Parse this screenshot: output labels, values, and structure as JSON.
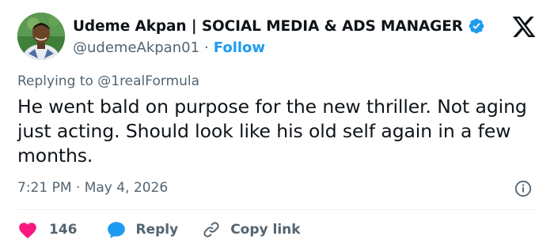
{
  "author": {
    "display_name": "Udeme Akpan | SOCIAL MEDIA & ADS MANAGER",
    "handle": "@udemeAkpan01",
    "separator": "·",
    "follow_label": "Follow",
    "verified": true
  },
  "brand_icon": "x-logo-icon",
  "reply_context": {
    "prefix": "Replying to",
    "mention": "@1realFormula"
  },
  "tweet": {
    "text": "He went bald on purpose for the new thriller. Not aging just acting. Should look like his old self again in a few months.",
    "timestamp": "7:21 PM · May 4, 2026"
  },
  "actions": {
    "like_count": "146",
    "reply_label": "Reply",
    "copy_link_label": "Copy link"
  },
  "colors": {
    "accent": "#1d9bf0",
    "like": "#f91880",
    "muted": "#536471",
    "text": "#0f1419"
  }
}
